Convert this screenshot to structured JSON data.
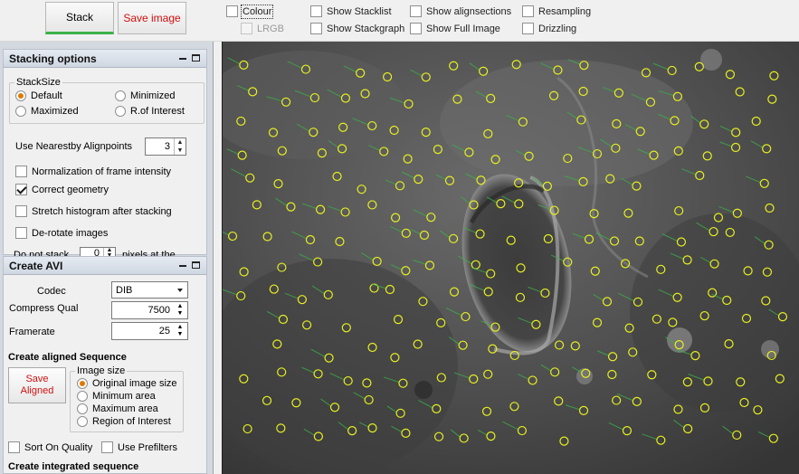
{
  "toolbar": {
    "stack_label": "Stack",
    "save_image_label": "Save image",
    "options": [
      {
        "label": "Colour",
        "checked": false,
        "enabled": true
      },
      {
        "label": "LRGB",
        "checked": false,
        "enabled": false
      },
      {
        "label": "Show Stacklist",
        "checked": false,
        "enabled": true
      },
      {
        "label": "Show Stackgraph",
        "checked": false,
        "enabled": true
      },
      {
        "label": "Show alignsections",
        "checked": false,
        "enabled": true
      },
      {
        "label": "Show Full Image",
        "checked": false,
        "enabled": true
      },
      {
        "label": "Resampling",
        "checked": false,
        "enabled": true
      },
      {
        "label": "Drizzling",
        "checked": false,
        "enabled": true
      }
    ]
  },
  "stacking": {
    "title": "Stacking options",
    "stacksize_title": "StackSize",
    "stacksize_options": [
      "Default",
      "Minimized",
      "Maximized",
      "R.of Interest"
    ],
    "stacksize_selected": "Default",
    "nearest_label": "Use Nearestby Alignpoints",
    "nearest_value": "3",
    "normalization_label": "Normalization of frame intensity",
    "normalization_checked": false,
    "correct_geometry_label": "Correct geometry",
    "correct_geometry_checked": true,
    "stretch_label": "Stretch histogram after stacking",
    "stretch_checked": false,
    "derotate_label": "De-rotate images",
    "derotate_checked": false,
    "donot_label": "Do not stack",
    "donot_value": "0",
    "pixels_label": "pixels at the"
  },
  "avi": {
    "title": "Create AVI",
    "codec_label": "Codec",
    "codec_value": "DIB",
    "compress_label": "Compress Qual",
    "compress_value": "7500",
    "framerate_label": "Framerate",
    "framerate_value": "25",
    "aligned_title": "Create aligned Sequence",
    "save_aligned_label": "Save Aligned",
    "imagesize_title": "Image size",
    "imagesize_options": [
      "Original image size",
      "Minimum area",
      "Maximum area",
      "Region of Interest"
    ],
    "imagesize_selected": "Original image size",
    "sort_label": "Sort On Quality",
    "sort_checked": false,
    "prefilters_label": "Use Prefilters",
    "prefilters_checked": false,
    "integrated_title": "Create integrated sequence"
  },
  "view": {
    "marker_color": "#e8f020",
    "vector_color": "#3cb04a"
  }
}
